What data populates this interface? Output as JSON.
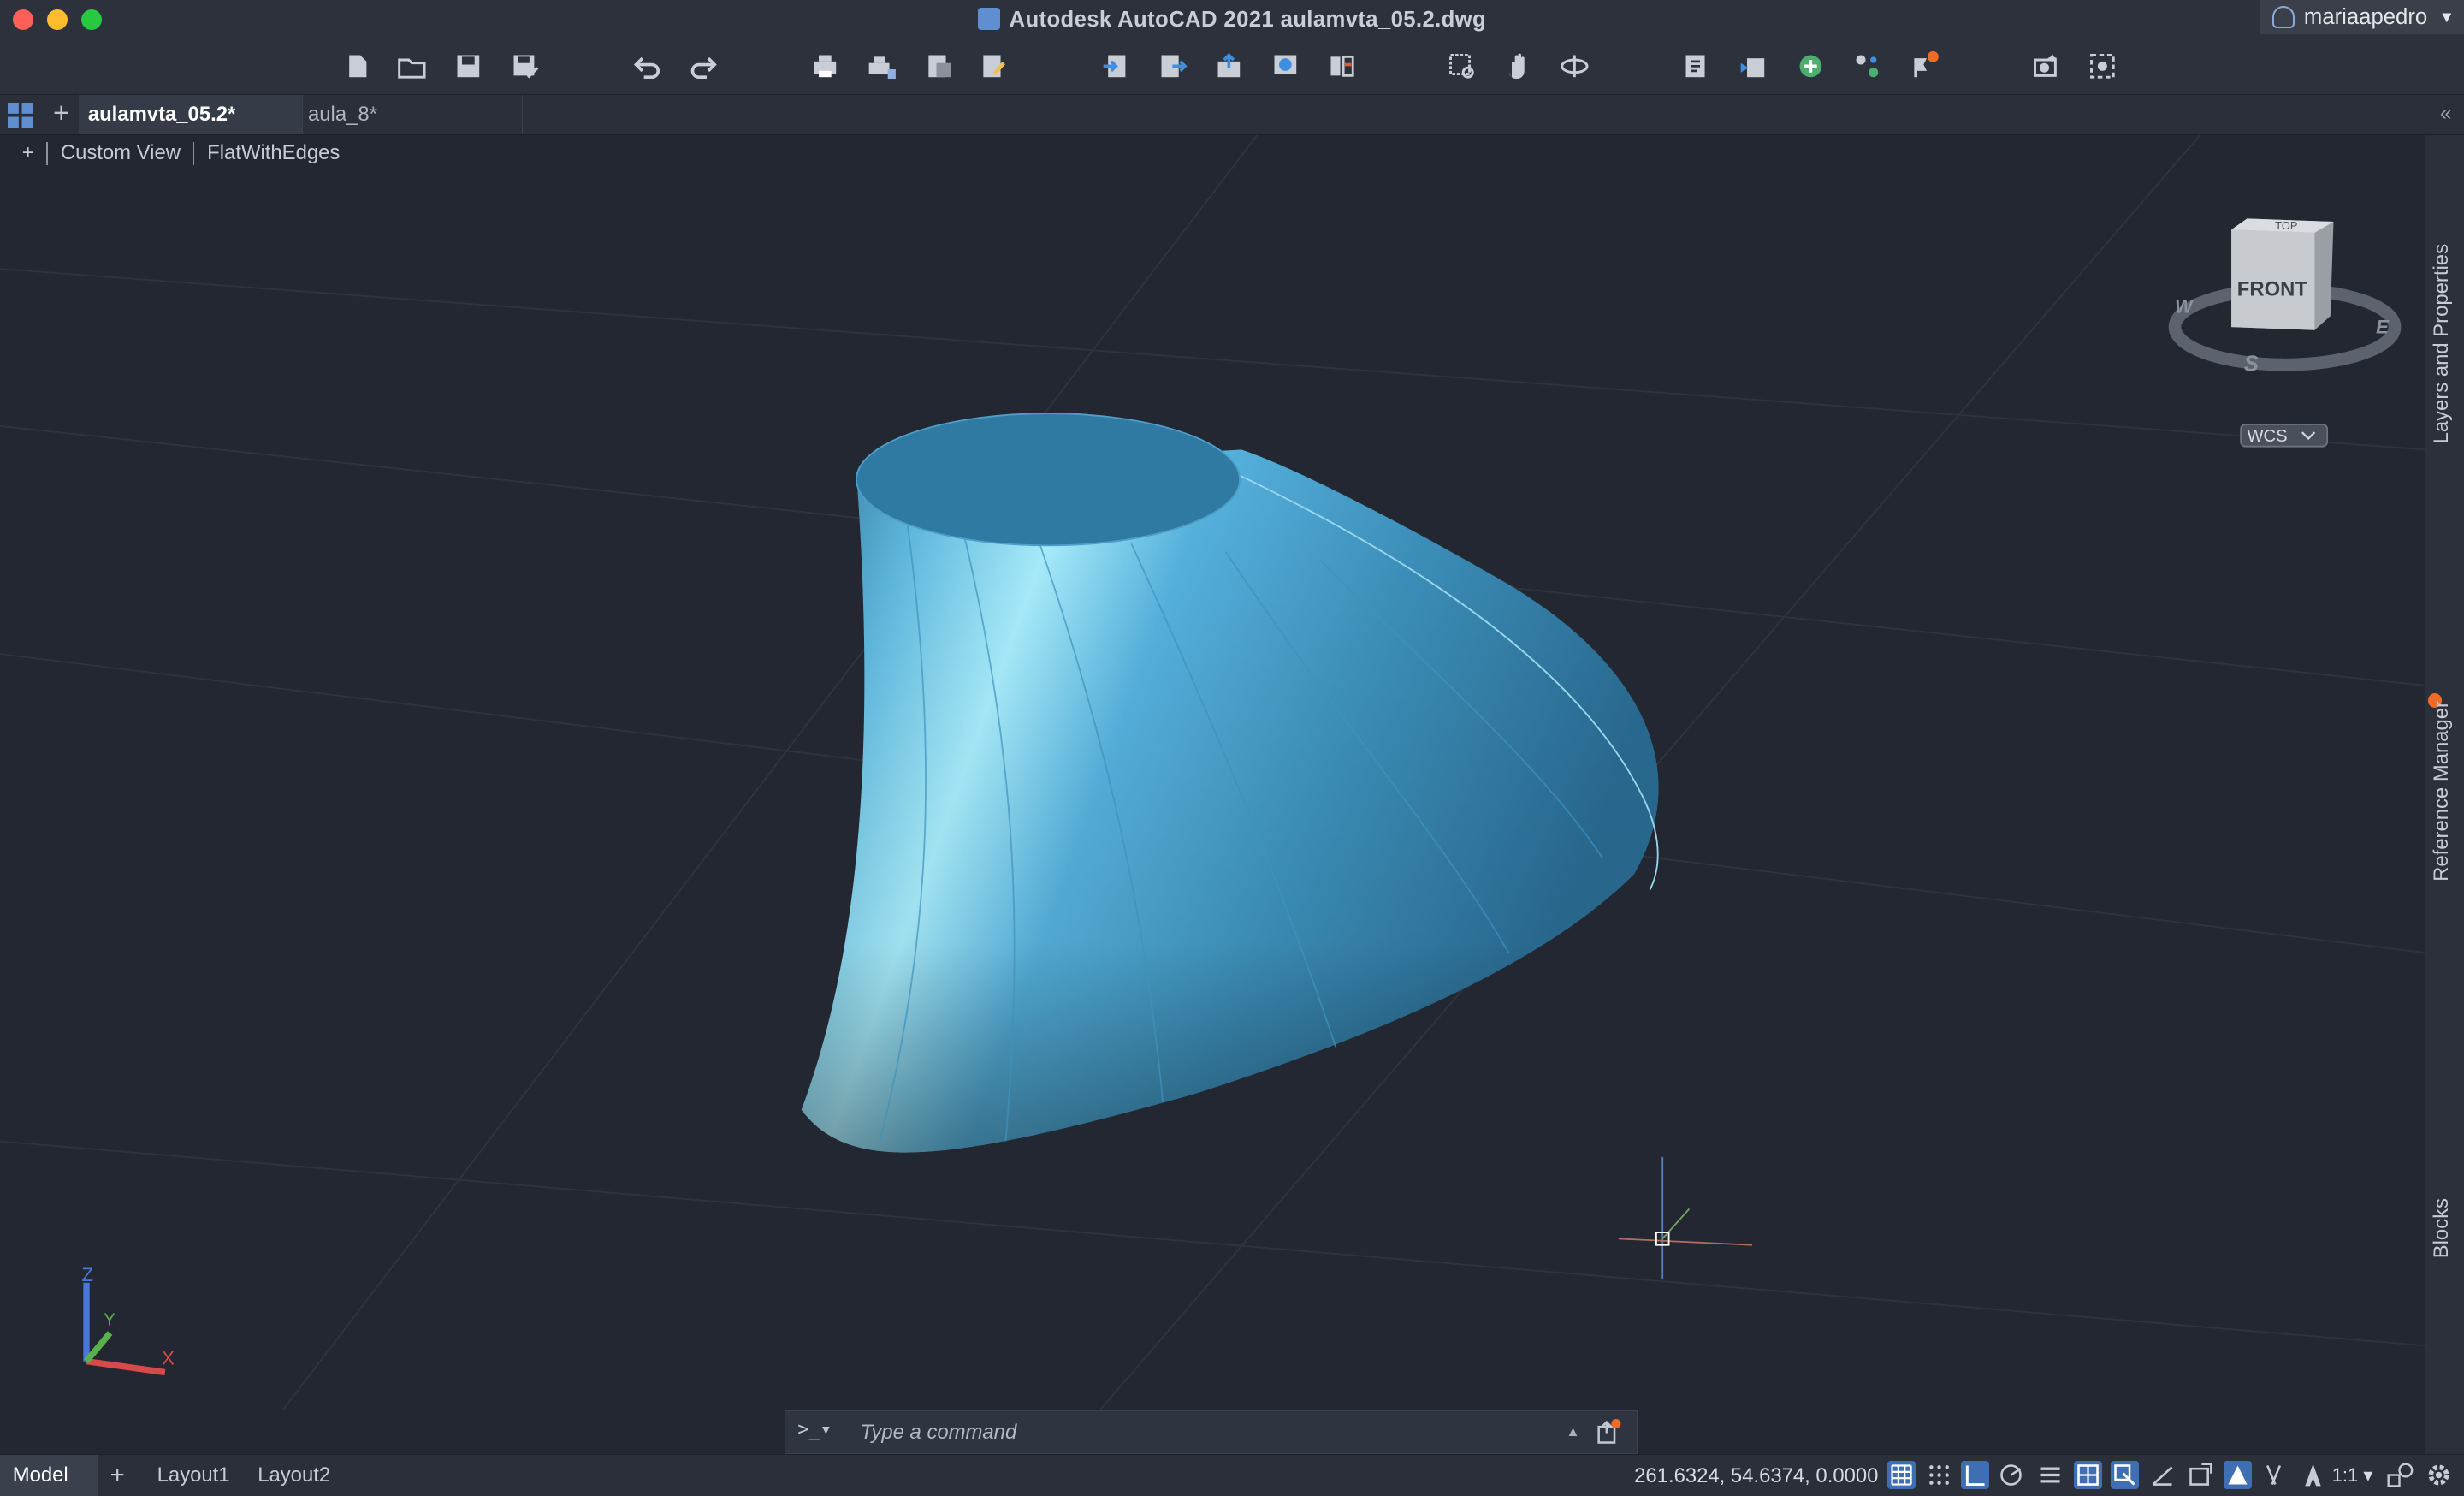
{
  "window": {
    "title": "Autodesk AutoCAD 2021    aulamvta_05.2.dwg",
    "user": "mariaapedro"
  },
  "toolbar_icons": [
    "new-icon",
    "open-icon",
    "save-icon",
    "save-as-icon",
    "undo-icon",
    "redo-icon",
    "plot-icon",
    "batch-plot-icon",
    "publish-icon",
    "page-setup-icon",
    "import-icon",
    "export-icon",
    "share-icon",
    "web-icon",
    "sheet-set-icon",
    "zoom-window-icon",
    "pan-icon",
    "orbit-icon",
    "layer-props-icon",
    "match-props-icon",
    "xref-icon",
    "attach-icon",
    "notification-icon",
    "render-icon",
    "view-icon"
  ],
  "tabs": [
    {
      "label": "aulamvta_05.2*",
      "active": true
    },
    {
      "label": "aula_8*",
      "active": false
    }
  ],
  "viewport": {
    "view_label": "Custom View",
    "visual_style": "FlatWithEdges",
    "plus": "+",
    "viewcube": {
      "face": "FRONT",
      "top": "TOP",
      "compass": {
        "w": "W",
        "e": "E",
        "s": "S"
      }
    },
    "wcs_label": "WCS",
    "ucs": {
      "x": "X",
      "y": "Y",
      "z": "Z"
    }
  },
  "side_panels": [
    "Layers and Properties",
    "Reference Manager",
    "Blocks"
  ],
  "command": {
    "prompt": ">_",
    "placeholder": "Type a command"
  },
  "status": {
    "layouts": [
      {
        "label": "Model",
        "active": true
      },
      {
        "label": "Layout1",
        "active": false
      },
      {
        "label": "Layout2",
        "active": false
      }
    ],
    "coordinates": "261.6324, 54.6374, 0.0000",
    "annotation_scale": "1:1"
  },
  "colors": {
    "background": "#222731",
    "surface": "#3b86b0",
    "accent": "#3f6fb2",
    "notification": "#f06a2a"
  }
}
